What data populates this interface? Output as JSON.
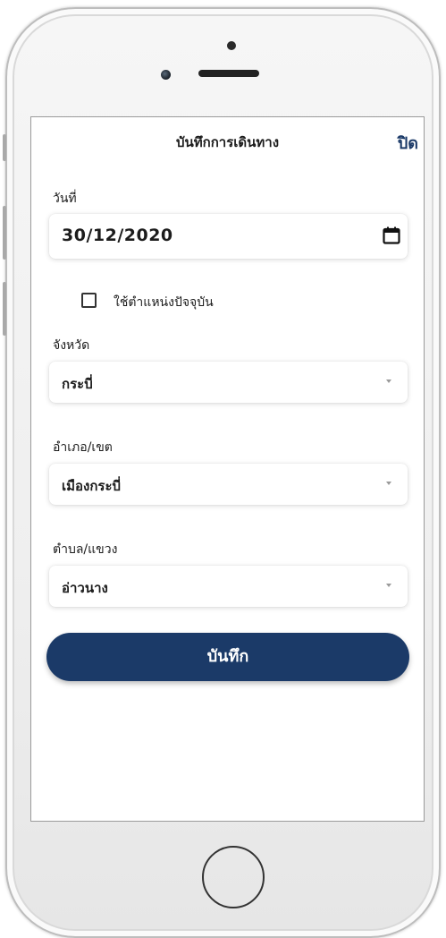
{
  "header": {
    "title": "บันทึกการเดินทาง",
    "close_label": "ปิด"
  },
  "date": {
    "label": "วันที่",
    "value": "30/12/2020",
    "icon": "calendar-icon"
  },
  "current_location": {
    "label": "ใช้ตำแหน่งปัจจุบัน",
    "checked": false
  },
  "province": {
    "label": "จังหวัด",
    "value": "กระบี่"
  },
  "district": {
    "label": "อำเภอ/เขต",
    "value": "เมืองกระบี่"
  },
  "subdistrict": {
    "label": "ตำบล/แขวง",
    "value": "อ่าวนาง"
  },
  "save_button": {
    "label": "บันทึก"
  },
  "colors": {
    "primary": "#1b3a68",
    "text": "#1c1c1c",
    "caret": "#9a9a9a"
  }
}
